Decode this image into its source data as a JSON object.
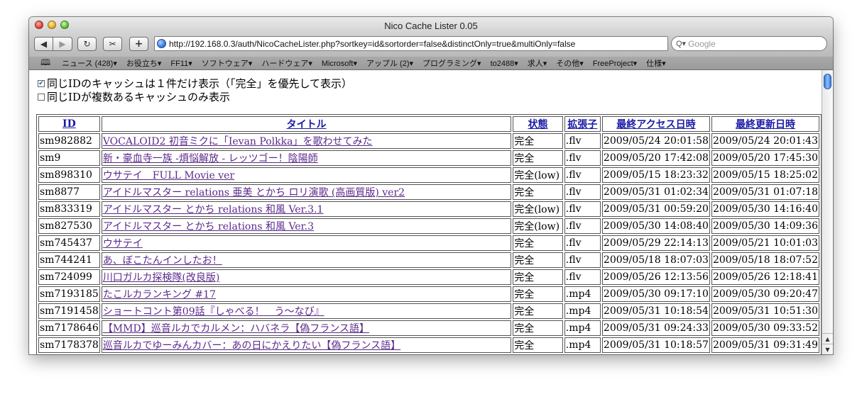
{
  "window": {
    "title": "Nico Cache Lister 0.05"
  },
  "toolbar": {
    "back_label": "◀",
    "forward_label": "▶",
    "reload_label": "↻",
    "snap_label": "✂",
    "add_label": "+",
    "url": "http://192.168.0.3/auth/NicoCacheLister.php?sortkey=id&sortorder=false&distinctOnly=true&multiOnly=false",
    "search_placeholder": "Google"
  },
  "bookmarks": [
    "ニュース (428)▾",
    "お役立ち▾",
    "FF11▾",
    "ソフトウェア▾",
    "ハードウェア▾",
    "Microsoft▾",
    "アップル (2)▾",
    "プログラミング▾",
    "to2488▾",
    "求人▾",
    "その他▾",
    "FreeProject▾",
    "仕様▾"
  ],
  "options": {
    "distinct_label": "同じIDのキャッシュは１件だけ表示（「完全」を優先して表示）",
    "distinct_checked": true,
    "multi_label": "同じIDが複数あるキャッシュのみ表示",
    "multi_checked": false
  },
  "table": {
    "headers": [
      "ID",
      "タイトル",
      "状態",
      "拡張子",
      "最終アクセス日時",
      "最終更新日時"
    ],
    "rows": [
      [
        "sm982882",
        "VOCALOID2 初音ミクに「Ievan Polkka」を歌わせてみた",
        "完全",
        ".flv",
        "2009/05/24 20:01:58",
        "2009/05/24 20:01:43"
      ],
      [
        "sm9",
        "新・豪血寺一族 -煩悩解放 - レッツゴー！陰陽師",
        "完全",
        ".flv",
        "2009/05/20 17:42:08",
        "2009/05/20 17:45:30"
      ],
      [
        "sm898310",
        "ウサテイ　FULL Movie ver",
        "完全(low)",
        ".flv",
        "2009/05/15 18:23:32",
        "2009/05/15 18:25:02"
      ],
      [
        "sm8877",
        "アイドルマスター relations 亜美 とかち ロリ演歌 (高画質版) ver2",
        "完全",
        ".flv",
        "2009/05/31 01:02:34",
        "2009/05/31 01:07:18"
      ],
      [
        "sm833319",
        "アイドルマスター とかち relations 和風 Ver.3.1",
        "完全(low)",
        ".flv",
        "2009/05/31 00:59:20",
        "2009/05/30 14:16:40"
      ],
      [
        "sm827530",
        "アイドルマスター とかち relations 和風 Ver.3",
        "完全(low)",
        ".flv",
        "2009/05/30 14:08:40",
        "2009/05/30 14:09:36"
      ],
      [
        "sm745437",
        "ウサテイ",
        "完全",
        ".flv",
        "2009/05/29 22:14:13",
        "2009/05/21 10:01:03"
      ],
      [
        "sm744241",
        "あ、ぼこたんインしたお！",
        "完全",
        ".flv",
        "2009/05/18 18:07:03",
        "2009/05/18 18:07:52"
      ],
      [
        "sm724099",
        "川口ガルカ探検隊(改良版)",
        "完全",
        ".flv",
        "2009/05/26 12:13:56",
        "2009/05/26 12:18:41"
      ],
      [
        "sm7193185",
        "たこルカランキング #17",
        "完全",
        ".mp4",
        "2009/05/30 09:17:10",
        "2009/05/30 09:20:47"
      ],
      [
        "sm7191458",
        "ショートコント第09話『しゃべる！　う～なび』",
        "完全",
        ".mp4",
        "2009/05/31 10:18:54",
        "2009/05/31 10:51:30"
      ],
      [
        "sm7178646",
        "【MMD】巡音ルカでカルメン：ハバネラ【偽フランス語】",
        "完全",
        ".mp4",
        "2009/05/31 09:24:33",
        "2009/05/30 09:33:52"
      ],
      [
        "sm7178378",
        "巡音ルカでゆーみんカバー：あの日にかえりたい【偽フランス語】",
        "完全",
        ".mp4",
        "2009/05/31 10:18:57",
        "2009/05/31 09:31:49"
      ]
    ]
  }
}
